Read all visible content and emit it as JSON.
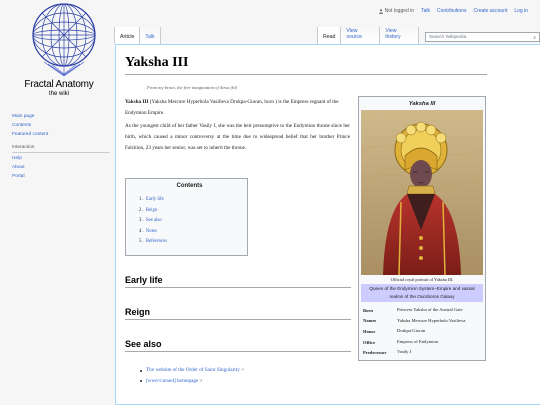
{
  "personal": {
    "not_logged_in": "Not logged in",
    "talk": "Talk",
    "contributions": "Contributions",
    "create_account": "Create account",
    "log_in": "Log in"
  },
  "logo": {
    "title": "Fractal Anatomy",
    "tagline": "the wiki"
  },
  "sidebar": {
    "main": [
      "Main page",
      "Contents",
      "Featured content"
    ],
    "interaction_heading": "Interaction",
    "interaction": [
      "Help",
      "About",
      "Portal"
    ]
  },
  "tabs": {
    "article": "Article",
    "talk": "Talk",
    "read": "Read",
    "view_source": "View source",
    "view_history": "View history"
  },
  "search": {
    "placeholder": "Search Wikipedia"
  },
  "page": {
    "title": "Yaksha III",
    "note": "From my brain, the free imagination of Sirus (hl)",
    "lead_bold": "Yaksha III",
    "lead_rest": " (Yaksha Mercure Hyperbola Vasilieva Drukpa-Gioran, born ) is the Empress regnant of the Endymion Empire.",
    "para2": "As the youngest child of her father Vasily I, she was the heir presumptive to the Endymion throne since her birth, which caused a minor controversy at the time due to widespread belief that her brother Prince Falchion, 23 years her senior, was set to inherit the throne."
  },
  "toc": {
    "title": "Contents",
    "items": [
      {
        "num": "1",
        "label": "Early life"
      },
      {
        "num": "2",
        "label": "Reign"
      },
      {
        "num": "3",
        "label": "See also"
      },
      {
        "num": "4",
        "label": "Notes"
      },
      {
        "num": "5",
        "label": "References"
      }
    ]
  },
  "sections": {
    "early_life": "Early life",
    "reign": "Reign",
    "see_also": "See also"
  },
  "see_also_links": [
    "The website of the Order of Saint Singularity",
    "[wwe//cursed] homepage"
  ],
  "infobox": {
    "title": "Yaksha III",
    "caption": "Official royal portrait of Yaksha III.",
    "subtitle": "Queen of the Endymion System–Empire and vassal realms of the Ouroboros Galaxy",
    "rows": [
      {
        "key": "Born",
        "value": "Princess Yaksha of the Austral Gate"
      },
      {
        "key": "Names",
        "value": "Yaksha Mercure Hyperbola Vasilieva"
      },
      {
        "key": "House",
        "value": "Drukpa-Gioran"
      },
      {
        "key": "Office",
        "value": "Empress of Endymion"
      },
      {
        "key": "Predecessor",
        "value": "Vasily I"
      }
    ]
  }
}
